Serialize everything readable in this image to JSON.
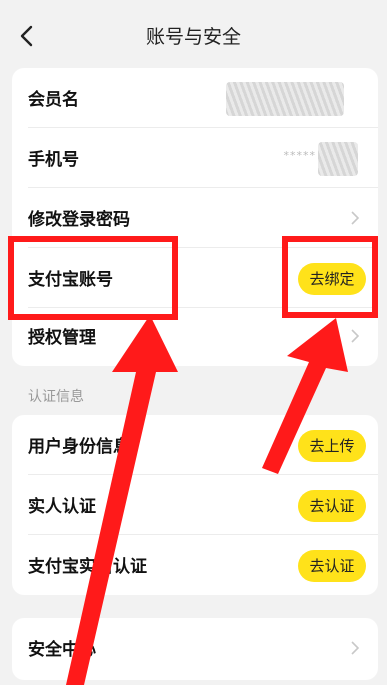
{
  "header": {
    "title": "账号与安全"
  },
  "account_rows": [
    {
      "label": "会员名"
    },
    {
      "label": "手机号",
      "value": "*****"
    },
    {
      "label": "修改登录密码"
    },
    {
      "label": "支付宝账号",
      "action": "去绑定"
    },
    {
      "label": "授权管理"
    }
  ],
  "verify_section": {
    "title": "认证信息",
    "rows": [
      {
        "label": "用户身份信息",
        "action": "去上传"
      },
      {
        "label": "实人认证",
        "action": "去认证"
      },
      {
        "label": "支付宝实名认证",
        "action": "去认证"
      }
    ]
  },
  "security_row": {
    "label": "安全中心"
  },
  "colors": {
    "accent": "#ffe21a",
    "annotation": "#ff1a1a",
    "background": "#f2f2f2"
  }
}
